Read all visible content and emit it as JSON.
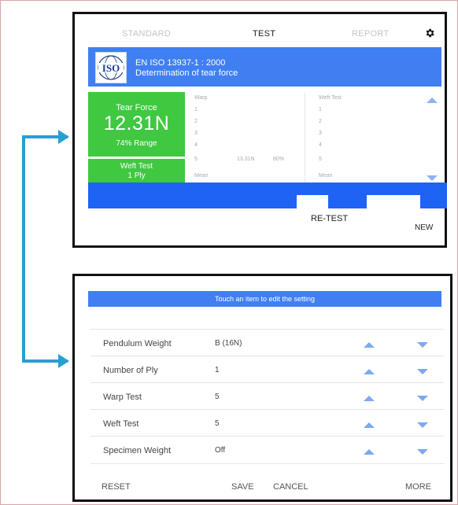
{
  "tabs": [
    "STANDARD",
    "TEST",
    "REPORT"
  ],
  "standard": {
    "badge": "ISO",
    "code": "EN ISO 13937-1 : 2000",
    "name": "Determination of tear force"
  },
  "result": {
    "label": "Tear Force",
    "value": "12.31N",
    "range": "74% Range"
  },
  "test_mode": {
    "line1": "Weft Test",
    "line2": "1 Ply"
  },
  "warp": {
    "header": "Warp",
    "rows": [
      "1",
      "2",
      "3",
      "4",
      "5"
    ],
    "row5_value": "13.31N",
    "row5_percent": "80%",
    "mean": "Mean"
  },
  "weft": {
    "header": "Weft Test",
    "rows": [
      "1",
      "2",
      "3",
      "4",
      "5"
    ],
    "mean": "Mean"
  },
  "top_buttons": {
    "retest": "RE-TEST",
    "new": "NEW"
  },
  "settings": {
    "hint": "Touch an item to edit the setting",
    "rows": [
      {
        "label": "Pendulum Weight",
        "value": "B (16N)"
      },
      {
        "label": "Number of Ply",
        "value": "1"
      },
      {
        "label": "Warp Test",
        "value": "5"
      },
      {
        "label": "Weft Test",
        "value": "5"
      },
      {
        "label": "Specimen Weight",
        "value": "Off"
      }
    ]
  },
  "footer": {
    "reset": "RESET",
    "save": "SAVE",
    "cancel": "CANCEL",
    "more": "MORE"
  },
  "colors": {
    "primary_blue": "#3f7ff2",
    "band_blue": "#1f63f5",
    "green": "#3fc840",
    "connector": "#2b9ed1"
  }
}
